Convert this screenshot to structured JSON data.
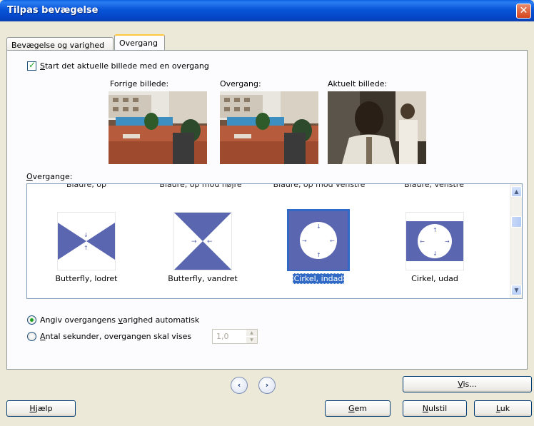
{
  "window": {
    "title": "Tilpas bevægelse",
    "close_glyph": "✕"
  },
  "tabs": [
    {
      "label": "Bevægelse og varighed",
      "active": false
    },
    {
      "label": "Overgang",
      "active": true
    }
  ],
  "start_checkbox": {
    "checked": true,
    "first_letter": "S",
    "rest": "tart det aktuelle billede med en overgang"
  },
  "previews": {
    "previous_label": "Forrige billede:",
    "transition_label": "Overgang:",
    "current_label": "Aktuelt billede:"
  },
  "transitions": {
    "label_first": "O",
    "label_rest": "vergange:",
    "partial_row": [
      "Blaure, op",
      "Blaure, op mod højre",
      "Blaure, op mod venstre",
      "Blaure, venstre"
    ],
    "items": [
      {
        "caption": "Butterfly, lodret",
        "icon": "butterfly-vertical-icon",
        "selected": false
      },
      {
        "caption": "Butterfly, vandret",
        "icon": "butterfly-horizontal-icon",
        "selected": false
      },
      {
        "caption": "Cirkel, indad",
        "icon": "circle-in-icon",
        "selected": true
      },
      {
        "caption": "Cirkel, udad",
        "icon": "circle-out-icon",
        "selected": false
      }
    ]
  },
  "duration": {
    "auto": {
      "pre": "Angiv overgangens ",
      "u": "v",
      "post": "arighed automatisk",
      "selected": true
    },
    "manual": {
      "u": "A",
      "post": "ntal sekunder, overgangen skal vises",
      "selected": false
    },
    "seconds_value": "1,0"
  },
  "buttons": {
    "help": {
      "u": "H",
      "rest": "jælp"
    },
    "show": {
      "u": "V",
      "rest": "is..."
    },
    "save": {
      "u": "G",
      "rest": "em"
    },
    "reset": {
      "u": "N",
      "rest": "ulstil"
    },
    "close": {
      "u": "L",
      "rest": "uk"
    }
  },
  "colors": {
    "accent": "#316AC5",
    "thumb_blue": "#5B66B0",
    "titlebar": "#0855D8"
  }
}
